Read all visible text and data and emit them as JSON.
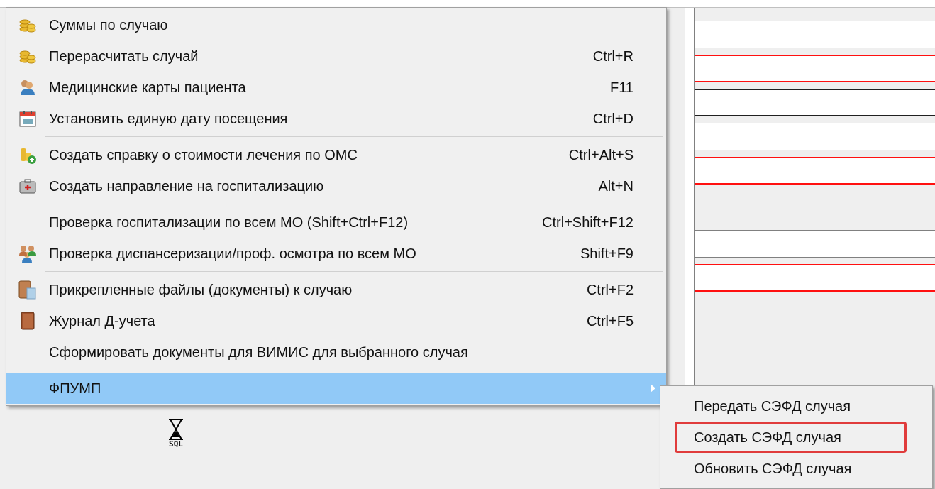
{
  "form": {
    "fields": [
      {
        "kind": "plain"
      },
      {
        "kind": "required"
      },
      {
        "kind": "focused"
      },
      {
        "kind": "plain"
      },
      {
        "kind": "required"
      },
      {
        "kind": "gap"
      },
      {
        "kind": "plain"
      },
      {
        "kind": "required"
      }
    ]
  },
  "context_menu": {
    "groups": [
      {
        "items": [
          {
            "label": "Суммы по случаю",
            "selected": false,
            "submenu": false
          },
          {
            "label": "Перерасчитать случай",
            "shortcut": "Ctrl+R",
            "selected": false,
            "submenu": false
          },
          {
            "label": "Медицинские карты пациента",
            "shortcut": "F11",
            "selected": false,
            "submenu": false
          },
          {
            "label": "Установить единую дату посещения",
            "shortcut": "Ctrl+D",
            "selected": false,
            "submenu": false
          }
        ]
      },
      {
        "items": [
          {
            "label": "Создать справку о стоимости лечения по ОМС",
            "shortcut": "Ctrl+Alt+S",
            "selected": false,
            "submenu": false
          },
          {
            "label": "Создать направление на госпитализацию",
            "shortcut": "Alt+N",
            "selected": false,
            "submenu": false
          }
        ]
      },
      {
        "items": [
          {
            "label": "Проверка госпитализации по всем МО (Shift+Ctrl+F12)",
            "shortcut": "Ctrl+Shift+F12",
            "selected": false,
            "submenu": false
          },
          {
            "label": "Проверка диспансеризации/проф. осмотра по всем МО",
            "shortcut": "Shift+F9",
            "selected": false,
            "submenu": false
          }
        ]
      },
      {
        "items": [
          {
            "label": "Прикрепленные файлы (документы) к случаю",
            "shortcut": "Ctrl+F2",
            "selected": false,
            "submenu": false
          },
          {
            "label": "Журнал Д-учета",
            "shortcut": "Ctrl+F5",
            "selected": false,
            "submenu": false
          },
          {
            "label": "Сформировать документы для ВИМИС для выбранного случая",
            "selected": false,
            "submenu": false
          }
        ]
      },
      {
        "items": [
          {
            "label": "ФПУМП",
            "selected": true,
            "submenu": true
          }
        ]
      }
    ]
  },
  "submenu": {
    "items": [
      {
        "label": "Передать СЭФД случая",
        "highlighted": false
      },
      {
        "label": "Создать СЭФД случая",
        "highlighted": true
      },
      {
        "label": "Обновить СЭФД случая",
        "highlighted": false
      }
    ]
  },
  "busy_cursor": {
    "label": "SQL"
  }
}
